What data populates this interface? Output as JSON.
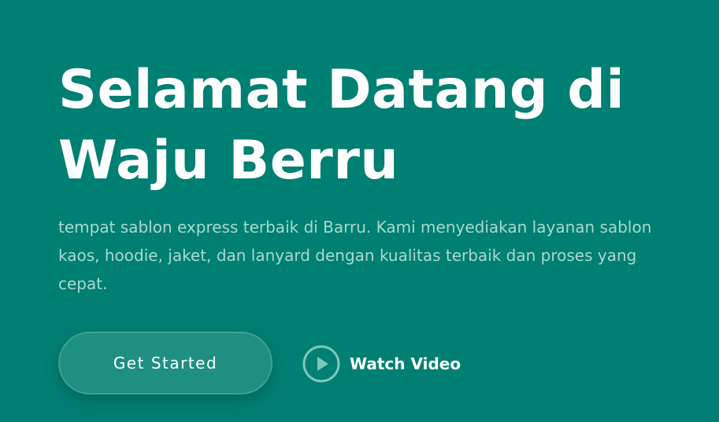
{
  "hero": {
    "title_line1": "Selamat Datang di",
    "title_line2": "Waju Berru",
    "description": "tempat sablon express terbaik di Barru. Kami menyediakan layanan sablon kaos, hoodie, jaket, dan lanyard dengan kualitas terbaik dan proses yang cepat.",
    "get_started_label": "Get Started",
    "watch_video_label": "Watch Video",
    "watch_video_icon": "play-circle-icon"
  },
  "colors": {
    "background": "#007f73",
    "button": "#1f8f82",
    "description_text": "#a9d8d0"
  }
}
